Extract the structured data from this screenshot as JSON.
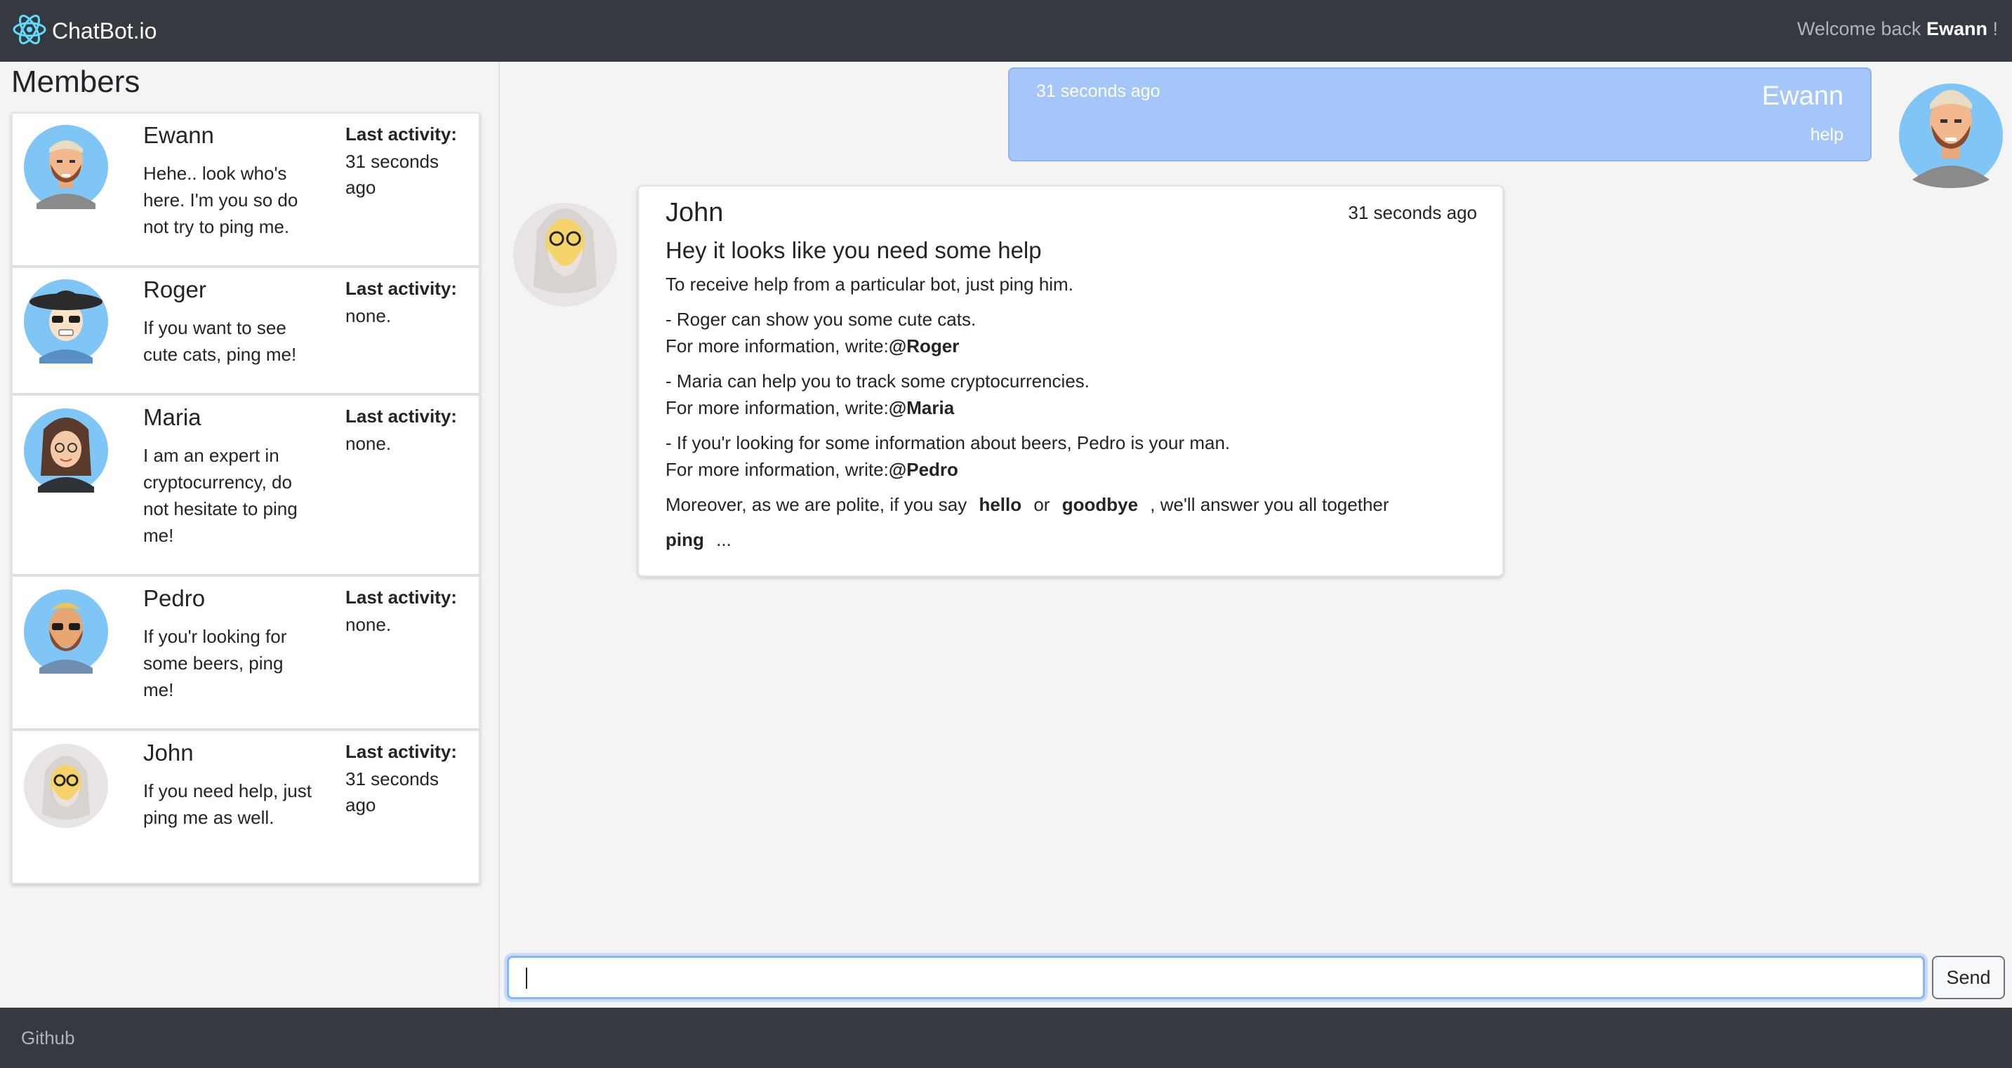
{
  "navbar": {
    "brand": "ChatBot.io",
    "welcome_prefix": "Welcome back",
    "username": "Ewann",
    "welcome_suffix": "!"
  },
  "sidebar": {
    "title": "Members",
    "last_activity_label": "Last activity:",
    "members": [
      {
        "name": "Ewann",
        "description": "Hehe.. look who's here. I'm you so do not try to ping me.",
        "last_activity": "31 seconds ago",
        "avatar_icon": "ewann-avatar-icon"
      },
      {
        "name": "Roger",
        "description": "If you want to see cute cats, ping me!",
        "last_activity": "none.",
        "avatar_icon": "roger-avatar-icon"
      },
      {
        "name": "Maria",
        "description": "I am an expert in cryptocurrency, do not hesitate to ping me!",
        "last_activity": "none.",
        "avatar_icon": "maria-avatar-icon"
      },
      {
        "name": "Pedro",
        "description": "If you'r looking for some beers, ping me!",
        "last_activity": "none.",
        "avatar_icon": "pedro-avatar-icon"
      },
      {
        "name": "John",
        "description": "If you need help, just ping me as well.",
        "last_activity": "31 seconds ago",
        "avatar_icon": "john-avatar-icon"
      }
    ]
  },
  "chat": {
    "my_message": {
      "time": "31 seconds ago",
      "author": "Ewann",
      "text": "help"
    },
    "bot_message": {
      "author": "John",
      "time": "31 seconds ago",
      "title": "Hey it looks like you need some help",
      "intro": "To receive help from a particular bot, just ping him.",
      "info_prefix": "For more information, write:",
      "items": [
        {
          "line": "- Roger can show you some cute cats.",
          "mention": "@Roger"
        },
        {
          "line": "- Maria can help you to track some cryptocurrencies.",
          "mention": "@Maria"
        },
        {
          "line": "- If you'r looking for some information about beers, Pedro is your man.",
          "mention": "@Pedro"
        }
      ],
      "polite_prefix": "Moreover, as we are polite, if you say",
      "hello": "hello",
      "or_word": "or",
      "goodbye": "goodbye",
      "polite_suffix": ", we'll answer you all together",
      "ping": "ping",
      "ellipsis": "..."
    },
    "input": {
      "value": "",
      "placeholder": ""
    },
    "send_label": "Send"
  },
  "footer": {
    "github_label": "Github"
  },
  "colors": {
    "navbar": "#343a40",
    "my_bubble": "#a4c6f8",
    "avatar_bg": "#7fc5f5",
    "input_focus": "#86b7fe"
  }
}
